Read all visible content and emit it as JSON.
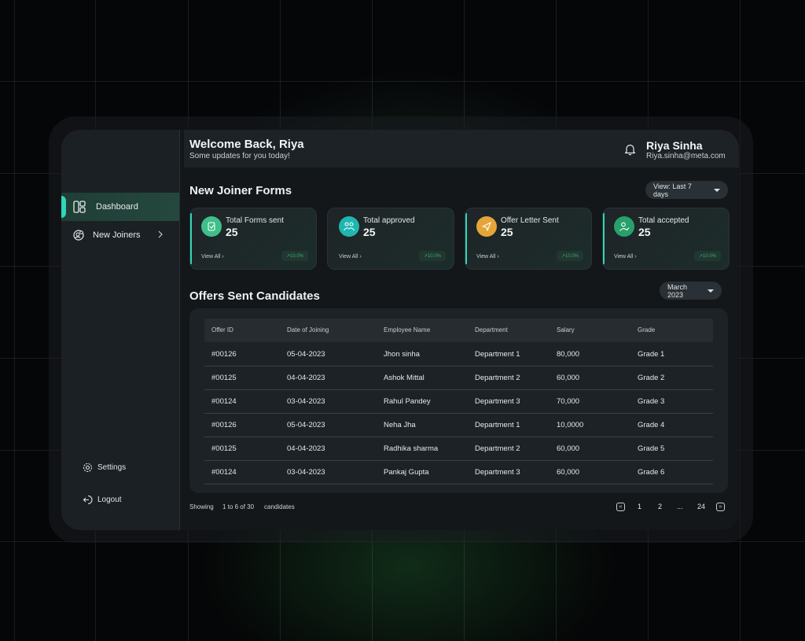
{
  "header": {
    "welcome": "Welcome Back, Riya",
    "subtitle": "Some updates for you today!",
    "user_name": "Riya Sinha",
    "user_email": "Riya.sinha@meta.com"
  },
  "sidebar": {
    "items": [
      {
        "label": "Dashboard",
        "icon": "dashboard-icon",
        "active": true
      },
      {
        "label": "New Joiners",
        "icon": "new-joiners-icon",
        "active": false
      }
    ],
    "bottom": [
      {
        "label": "Settings",
        "icon": "gear-icon"
      },
      {
        "label": "Logout",
        "icon": "logout-icon"
      }
    ]
  },
  "forms": {
    "title": "New Joiner Forms",
    "filter": "View: Last 7 days",
    "cards": [
      {
        "label": "Total Forms sent",
        "value": "25",
        "view": "View All",
        "trend": "10.0%",
        "color": "#3fbf8a"
      },
      {
        "label": "Total approved",
        "value": "25",
        "view": "View All",
        "trend": "10.0%",
        "color": "#1fb6b0"
      },
      {
        "label": "Offer Letter Sent",
        "value": "25",
        "view": "View All",
        "trend": "10.0%",
        "color": "#e6a538"
      },
      {
        "label": "Total accepted",
        "value": "25",
        "view": "View All",
        "trend": "10.0%",
        "color": "#28a06a"
      }
    ]
  },
  "offers": {
    "title": "Offers Sent Candidates",
    "filter": "March 2023",
    "columns": [
      "Offer ID",
      "Date of Joining",
      "Employee Name",
      "Department",
      "Salary",
      "Grade"
    ],
    "rows": [
      [
        "#00126",
        "05-04-2023",
        "Jhon sinha",
        "Department 1",
        "80,000",
        "Grade 1"
      ],
      [
        "#00125",
        "04-04-2023",
        "Ashok Mittal",
        "Department 2",
        "60,000",
        "Grade 2"
      ],
      [
        "#00124",
        "03-04-2023",
        "Rahul Pandey",
        "Department 3",
        "70,000",
        "Grade 3"
      ],
      [
        "#00126",
        "05-04-2023",
        "Neha Jha",
        "Department 1",
        "10,0000",
        "Grade 4"
      ],
      [
        "#00125",
        "04-04-2023",
        "Radhika sharma",
        "Department 2",
        "60,000",
        "Grade 5"
      ],
      [
        "#00124",
        "03-04-2023",
        "Pankaj Gupta",
        "Department 3",
        "60,000",
        "Grade 6"
      ]
    ]
  },
  "pagination": {
    "showing": "Showing",
    "range": "1 to 6 of 30",
    "suffix": "candidates",
    "pages": [
      "1",
      "2",
      "...",
      "24"
    ]
  },
  "colors": {
    "accent": "#2fd6b7",
    "background": "#13171a",
    "sidebar": "#1b2024"
  }
}
